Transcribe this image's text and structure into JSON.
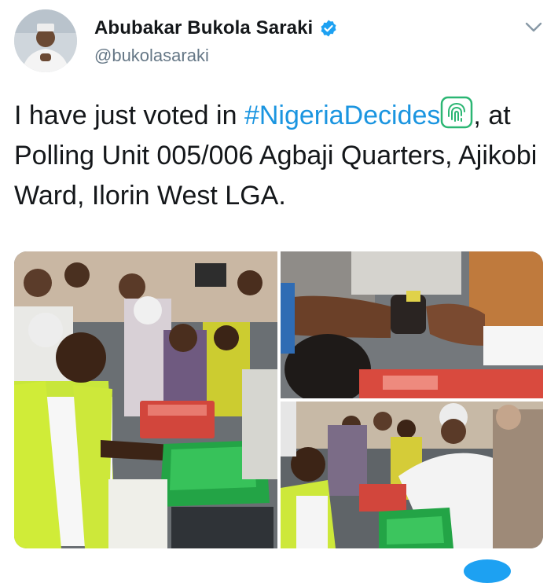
{
  "tweet": {
    "display_name": "Abubakar Bukola Saraki",
    "handle": "@bukolasaraki",
    "text_before": "I have just voted in ",
    "hashtag": "#NigeriaDecides",
    "text_after": ", at Polling Unit 005/006 Agbaji Quarters, Ajikobi Ward, Ilorin West LGA.",
    "emoji": "fingerprint-emoji"
  },
  "icons": {
    "verified": "verified-badge-icon",
    "menu": "chevron-down-icon"
  },
  "colors": {
    "hashtag": "#1b95e0",
    "verified": "#1da1f2",
    "handle": "#657786",
    "text": "#14171a"
  }
}
